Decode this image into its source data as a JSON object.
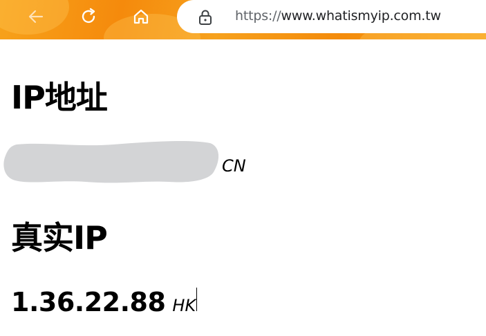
{
  "browser": {
    "back_icon": "arrow-left-icon",
    "reload_icon": "reload-icon",
    "home_icon": "home-icon",
    "lock_icon": "lock-icon",
    "url_scheme": "https://",
    "url_host": "www.whatismyip.com.tw",
    "theme_colors": {
      "toolbar_primary": "#f58a0c",
      "toolbar_secondary": "#f7a21b"
    }
  },
  "page": {
    "ip_heading": "IP地址",
    "ip_country": "CN",
    "real_ip_heading": "真实IP",
    "real_ip_value": "1.36.22.88",
    "real_ip_country": "HK"
  }
}
